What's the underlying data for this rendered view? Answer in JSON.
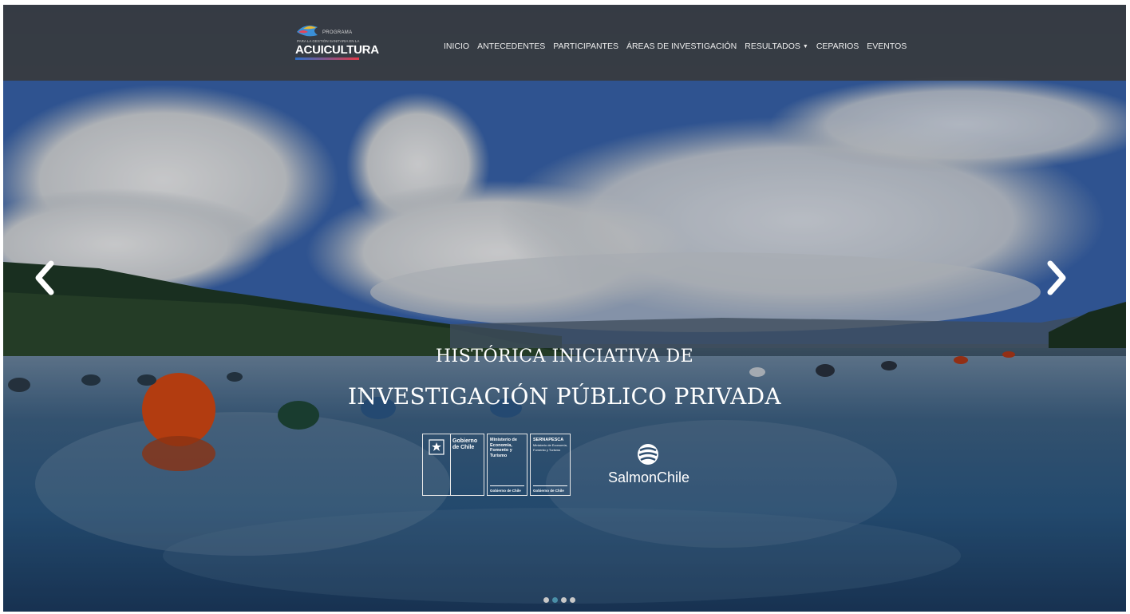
{
  "brand": {
    "logo_top": "PROGRAMA",
    "logo_sub": "PARA LA GESTIÓN SANITARIA EN LA",
    "logo_main": "ACUICULTURA"
  },
  "nav": {
    "items": [
      "INICIO",
      "ANTECEDENTES",
      "PARTICIPANTES",
      "ÁREAS DE INVESTIGACIÓN",
      "RESULTADOS",
      "CEPARIOS",
      "EVENTOS"
    ]
  },
  "slider": {
    "caption_line1": "HISTÓRICA INICIATIVA DE",
    "caption_line2": "INVESTIGACIÓN PÚBLICO PRIVADA",
    "prev_icon": "chevron-left-icon",
    "next_icon": "chevron-right-icon",
    "active_index": 1,
    "total": 4
  },
  "partners": {
    "gobierno": "Gobierno de Chile",
    "ministerio": "Ministerio de Economía, Fomento y Turismo",
    "ministerio_foot": "Gobierno de Chile",
    "sernapesca": "SERNAPESCA",
    "sernapesca_sub": "Ministerio de Economía, Fomento y Turismo",
    "sernapesca_foot": "Gobierno de Chile",
    "salmonchile": "SalmonChile"
  },
  "colors": {
    "navbar": "#373737",
    "accent_dot": "#4a8fa8"
  }
}
